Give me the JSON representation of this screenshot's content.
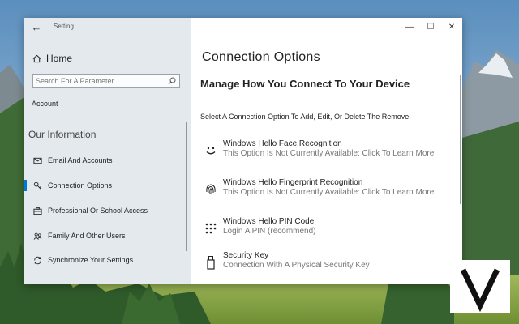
{
  "window": {
    "title": "Setting",
    "controls": {
      "minimize": "—",
      "maximize": "☐",
      "close": "✕"
    }
  },
  "sidebar": {
    "home_label": "Home",
    "search_placeholder": "Search For A Parameter",
    "account_label": "Account",
    "section_title": "Our Information",
    "items": [
      {
        "label": "Email And Accounts",
        "icon": "mail-icon"
      },
      {
        "label": "Connection Options",
        "icon": "key-icon",
        "active": true
      },
      {
        "label": "Professional Or School Access",
        "icon": "briefcase-icon"
      },
      {
        "label": "Family And Other Users",
        "icon": "people-icon"
      },
      {
        "label": "Synchronize Your Settings",
        "icon": "sync-icon"
      }
    ]
  },
  "main": {
    "page_title": "Connection Options",
    "heading": "Manage How You Connect To Your Device",
    "description": "Select A Connection Option To Add, Edit, Or Delete The Remove.",
    "options": [
      {
        "title": "Windows Hello Face Recognition",
        "desc": "This Option Is Not Currently Available: Click To Learn More",
        "icon": "smiley-face-icon"
      },
      {
        "title": "Windows Hello Fingerprint Recognition",
        "desc": "This Option Is Not Currently Available: Click To Learn More",
        "icon": "fingerprint-icon"
      },
      {
        "title": "Windows Hello PIN Code",
        "desc": "Login A PIN (recommend)",
        "icon": "pin-keypad-icon"
      },
      {
        "title": "Security Key",
        "desc": "Connection With A Physical Security Key",
        "icon": "usb-key-icon"
      }
    ]
  },
  "colors": {
    "accent": "#0078d7",
    "sidebar_bg": "#e2e7ec"
  },
  "watermark": {
    "letter": "V"
  }
}
